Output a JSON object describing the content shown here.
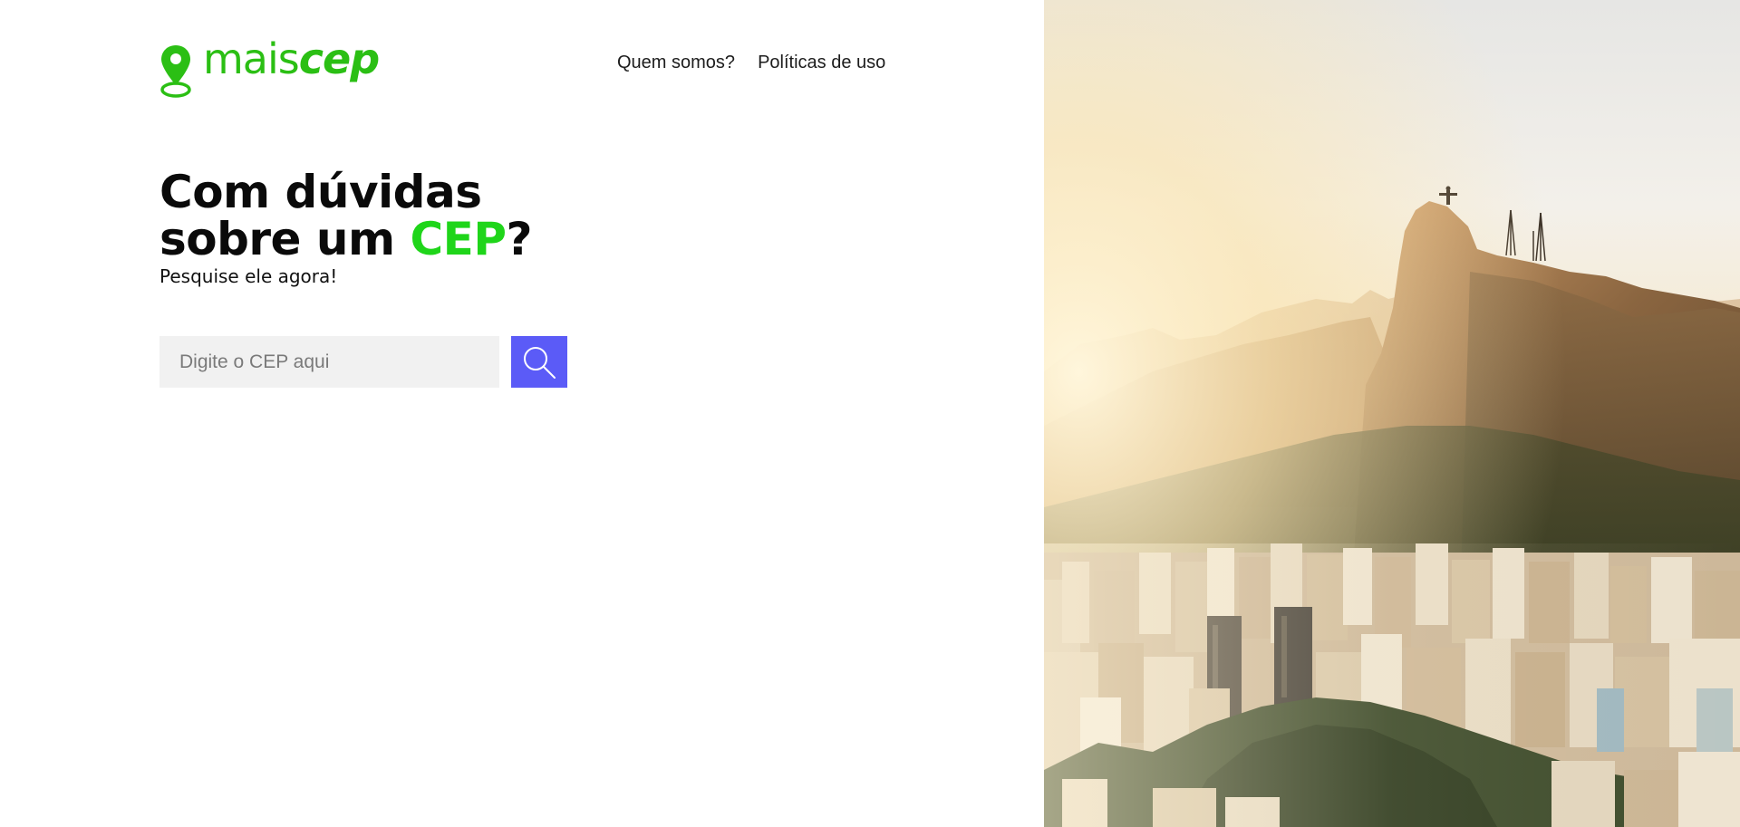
{
  "brand": {
    "name_light": "mais",
    "name_bold": "cep",
    "color": "#2bbf14",
    "icon": "map-pin-icon"
  },
  "nav": {
    "items": [
      {
        "label": "Quem somos?"
      },
      {
        "label": "Políticas de uso"
      }
    ]
  },
  "hero": {
    "title_line1": "Com dúvidas",
    "title_line2_prefix": "sobre um ",
    "title_accent": "CEP",
    "title_line2_suffix": "?",
    "accent_color": "#1fd51a",
    "subtitle": "Pesquise ele agora!"
  },
  "search": {
    "placeholder": "Digite o CEP aqui",
    "value": "",
    "button_icon": "search-icon",
    "button_color": "#5b5bf7"
  },
  "hero_image": {
    "subject": "city-mountain-photo"
  }
}
